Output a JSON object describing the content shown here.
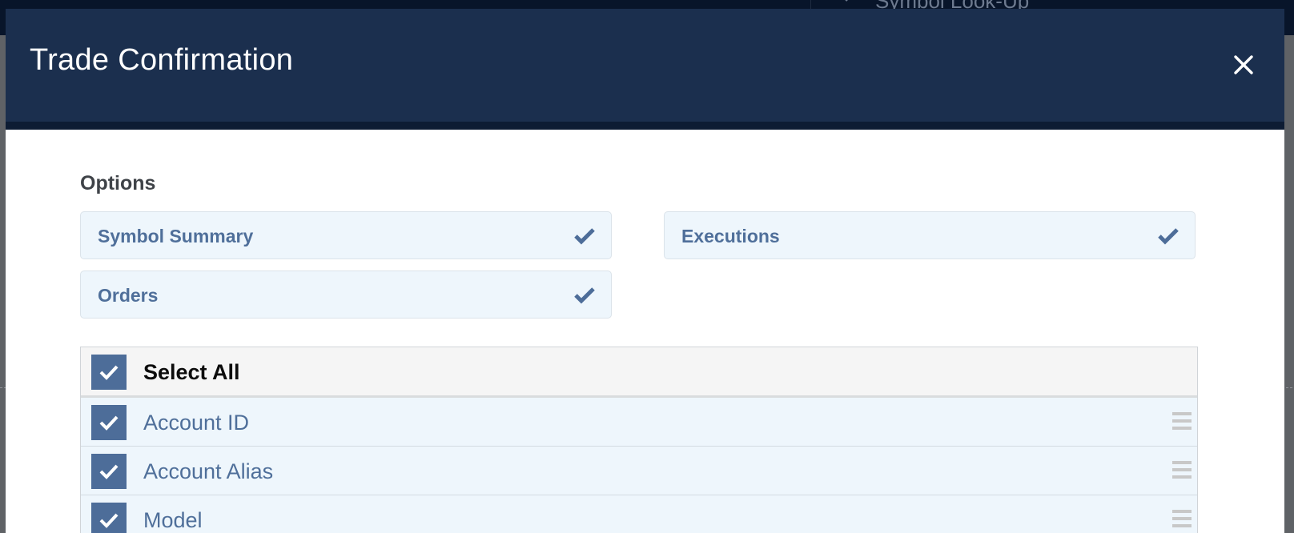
{
  "backdrop": {
    "search_placeholder": "Symbol Look-Up",
    "search_icon": "search-icon"
  },
  "modal": {
    "title": "Trade Confirmation",
    "close_icon": "close-icon"
  },
  "options": {
    "label": "Options",
    "items": [
      {
        "label": "Symbol Summary",
        "checked": true
      },
      {
        "label": "Executions",
        "checked": true
      },
      {
        "label": "Orders",
        "checked": true
      }
    ]
  },
  "columns": {
    "select_all": {
      "label": "Select All",
      "checked": true
    },
    "rows": [
      {
        "label": "Account ID",
        "checked": true
      },
      {
        "label": "Account Alias",
        "checked": true
      },
      {
        "label": "Model",
        "checked": true
      }
    ]
  },
  "colors": {
    "header": "#1b2f4e",
    "accent": "#4d6d99",
    "option_bg": "#eef6fc",
    "option_text": "#4f6f9a"
  }
}
